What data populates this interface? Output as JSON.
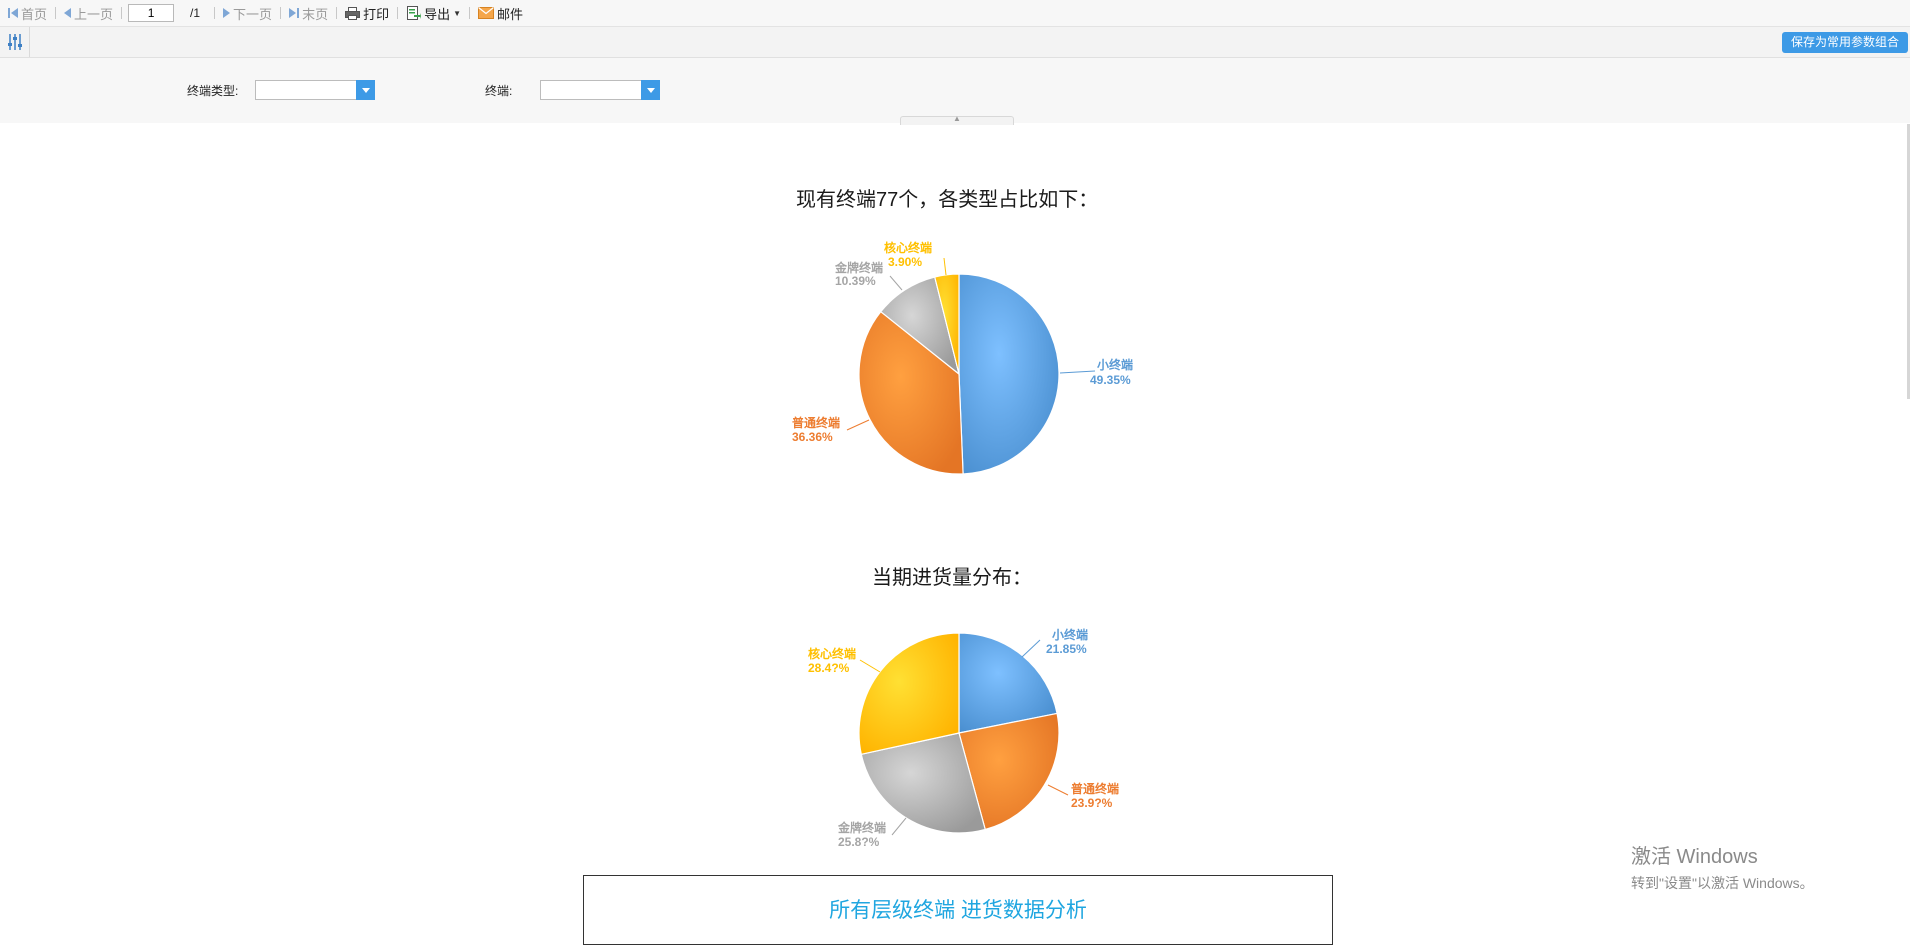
{
  "toolbar": {
    "first": "首页",
    "prev": "上一页",
    "page_value": "1",
    "page_total": "/1",
    "next": "下一页",
    "last": "末页",
    "print": "打印",
    "export": "导出",
    "mail": "邮件"
  },
  "params": {
    "save_label": "保存为常用参数组合",
    "terminal_type_label": "终端类型:",
    "terminal_type_value": "",
    "terminal_label": "终端:",
    "terminal_value": ""
  },
  "colors": {
    "blue": "#5b9bd5",
    "orange": "#ed7d31",
    "gray": "#a5a5a5",
    "yellow": "#ffc000",
    "accent": "#3d9ae6"
  },
  "chart_data": [
    {
      "type": "pie",
      "title": "现有终端77个，各类型占比如下：",
      "slices": [
        {
          "name": "小终端",
          "value": 49.35,
          "label": "49.35%",
          "color": "#5b9bd5"
        },
        {
          "name": "普通终端",
          "value": 36.36,
          "label": "36.36%",
          "color": "#ed7d31"
        },
        {
          "name": "金牌终端",
          "value": 10.39,
          "label": "10.39%",
          "color": "#a5a5a5"
        },
        {
          "name": "核心终端",
          "value": 3.9,
          "label": "3.90%",
          "color": "#ffc000"
        }
      ]
    },
    {
      "type": "pie",
      "title": "当期进货量分布：",
      "slices": [
        {
          "name": "小终端",
          "value": 21.85,
          "label": "21.85%",
          "color": "#5b9bd5"
        },
        {
          "name": "普通终端",
          "value": 23.9,
          "label": "23.9?%",
          "color": "#ed7d31"
        },
        {
          "name": "金牌终端",
          "value": 25.8,
          "label": "25.8?%",
          "color": "#a5a5a5"
        },
        {
          "name": "核心终端",
          "value": 28.4,
          "label": "28.4?%",
          "color": "#ffc000"
        }
      ]
    }
  ],
  "table": {
    "title": "所有层级终端 进货数据分析"
  },
  "watermark": {
    "line1": "激活 Windows",
    "line2": "转到\"设置\"以激活 Windows。"
  }
}
